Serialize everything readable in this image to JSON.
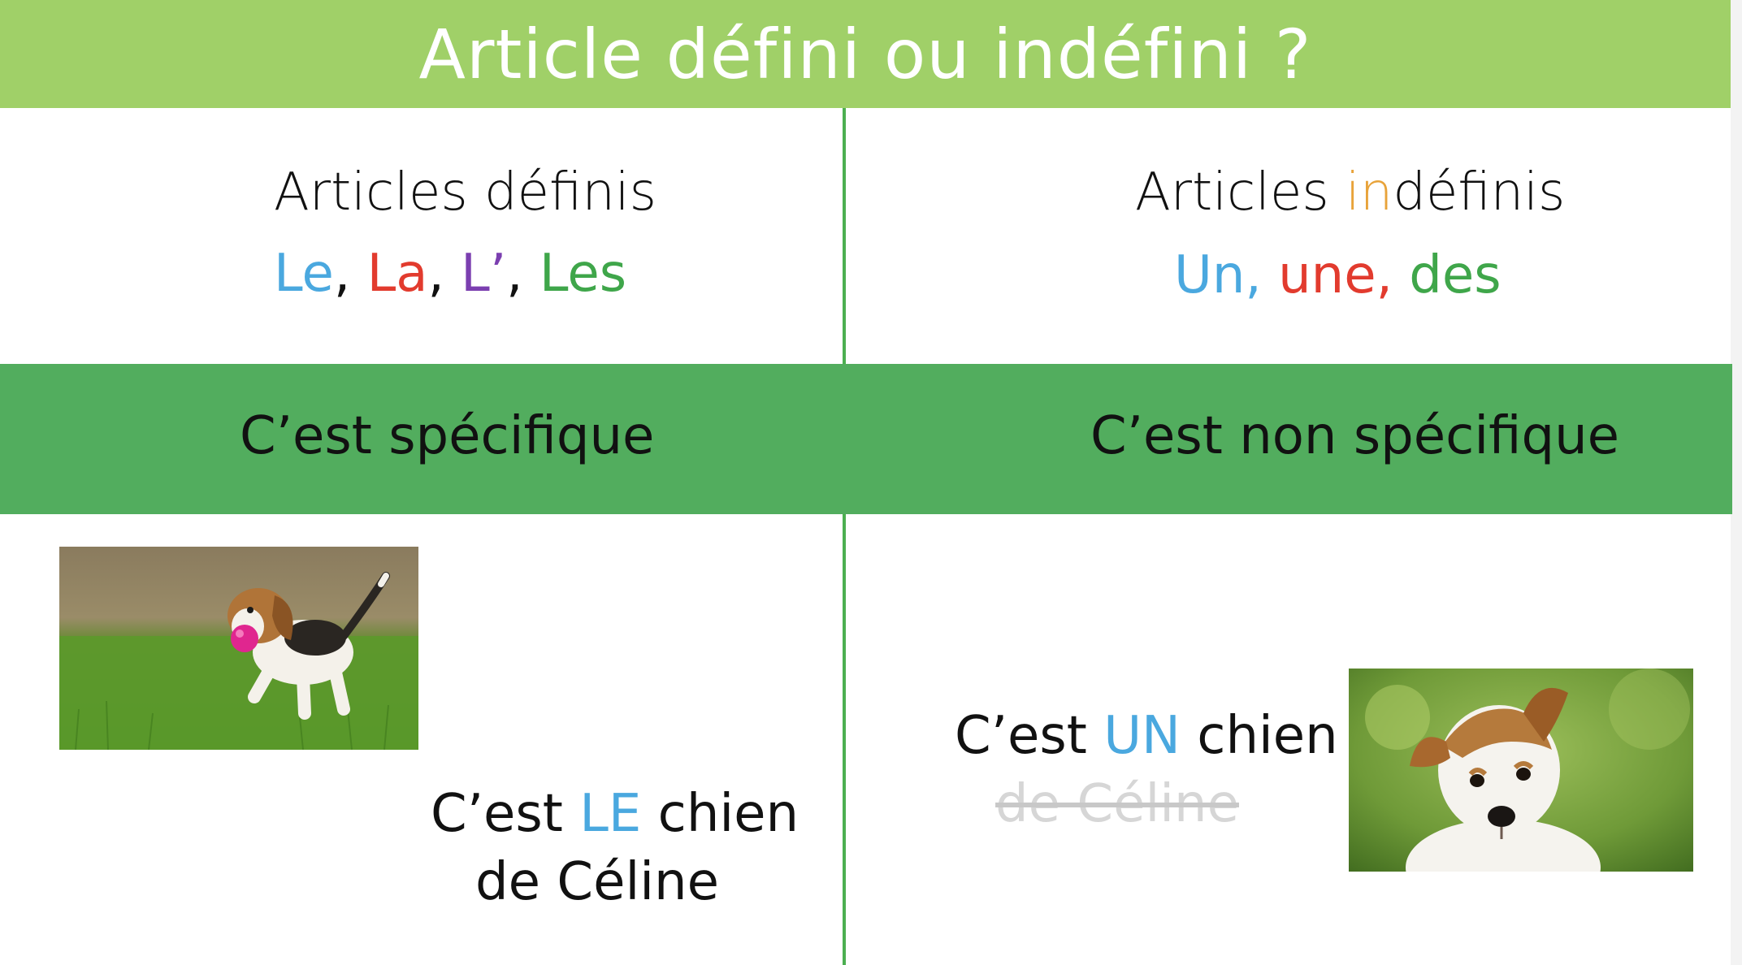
{
  "title": "Article défini ou indéfini ?",
  "left": {
    "heading": "Articles définis",
    "articles": [
      {
        "text": "Le",
        "color": "#4aa8df"
      },
      {
        "text": ", ",
        "color": "#111111"
      },
      {
        "text": "La",
        "color": "#e23b2e"
      },
      {
        "text": ", ",
        "color": "#111111"
      },
      {
        "text": "L’",
        "color": "#7b3fb0"
      },
      {
        "text": ", ",
        "color": "#111111"
      },
      {
        "text": "Les",
        "color": "#3fa64a"
      }
    ],
    "band_label": "C’est spécifique",
    "photo_icon": "beagle-puppy-with-pink-ball",
    "sentence_pre": "C’est ",
    "sentence_article": "LE",
    "sentence_post": " chien",
    "sentence_line2": "de Céline"
  },
  "right": {
    "heading_pre": "Articles ",
    "heading_highlight": "in",
    "heading_post": "définis",
    "articles": [
      {
        "text": "Un, ",
        "color": "#4aa8df"
      },
      {
        "text": "une, ",
        "color": "#e23b2e"
      },
      {
        "text": "des",
        "color": "#3fa64a"
      }
    ],
    "band_label": "C’est non spécifique",
    "photo_icon": "terrier-dog-head-tilted",
    "sentence_pre": "C’est ",
    "sentence_article": "UN",
    "sentence_post": " chien",
    "sentence_struck": "de Céline"
  },
  "colors": {
    "title_bar": "#a0d068",
    "band": "#52ad5e",
    "divider": "#4caf50"
  }
}
